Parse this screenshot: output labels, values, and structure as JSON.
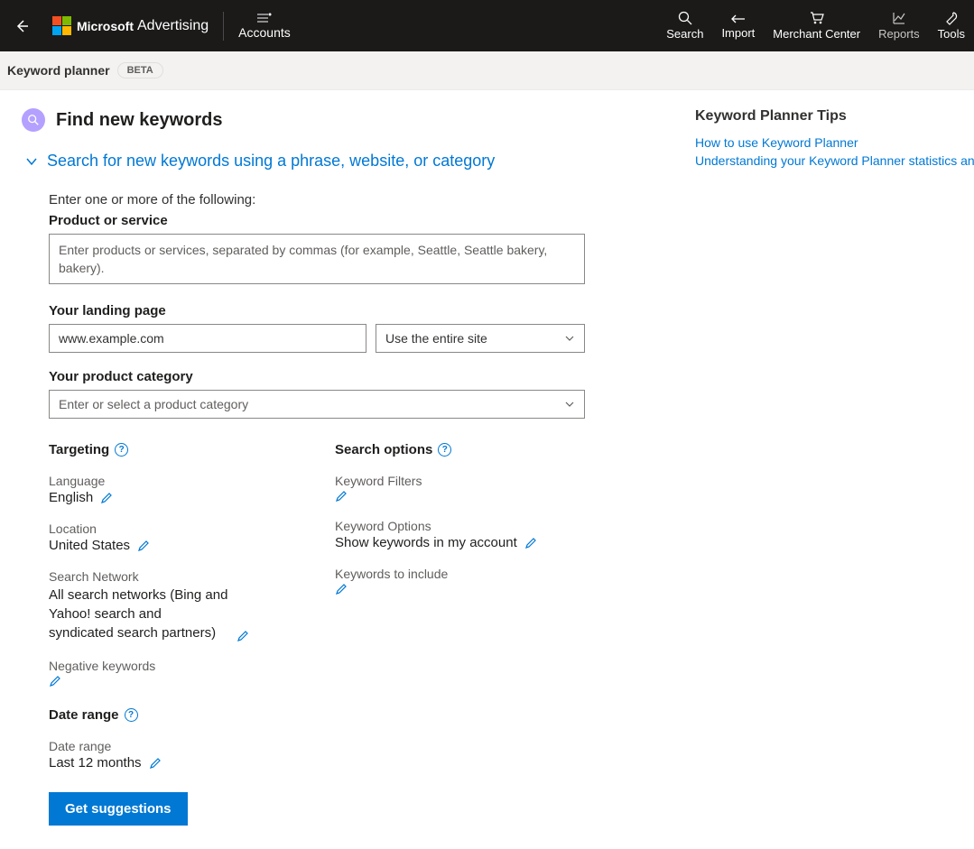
{
  "header": {
    "brand1": "Microsoft",
    "brand2": "Advertising",
    "accounts": "Accounts",
    "nav": {
      "search": "Search",
      "import": "Import",
      "merchant": "Merchant Center",
      "reports": "Reports",
      "tools": "Tools"
    }
  },
  "subbar": {
    "title": "Keyword planner",
    "badge": "BETA"
  },
  "page": {
    "heading": "Find new keywords",
    "accordion_title": "Search for new keywords using a phrase, website, or category",
    "intro": "Enter one or more of the following:",
    "product_label": "Product or service",
    "product_placeholder": "Enter products or services, separated by commas (for example, Seattle, Seattle bakery, bakery).",
    "landing_label": "Your landing page",
    "landing_value": "www.example.com",
    "site_scope": "Use the entire site",
    "category_label": "Your product category",
    "category_placeholder": "Enter or select a product category",
    "targeting_heading": "Targeting",
    "search_options_heading": "Search options",
    "language_label": "Language",
    "language_value": "English",
    "location_label": "Location",
    "location_value": "United States",
    "network_label": "Search Network",
    "network_value": "All search networks (Bing and Yahoo! search and syndicated search partners)",
    "negative_label": "Negative keywords",
    "date_heading": "Date range",
    "date_label": "Date range",
    "date_value": "Last 12 months",
    "filters_label": "Keyword Filters",
    "options_label": "Keyword Options",
    "options_value": "Show keywords in my account",
    "include_label": "Keywords to include",
    "submit": "Get suggestions"
  },
  "tips": {
    "heading": "Keyword Planner Tips",
    "link1": "How to use Keyword Planner",
    "link2": "Understanding your Keyword Planner statistics and traffic estimates"
  },
  "glyphs": {
    "help": "?"
  }
}
